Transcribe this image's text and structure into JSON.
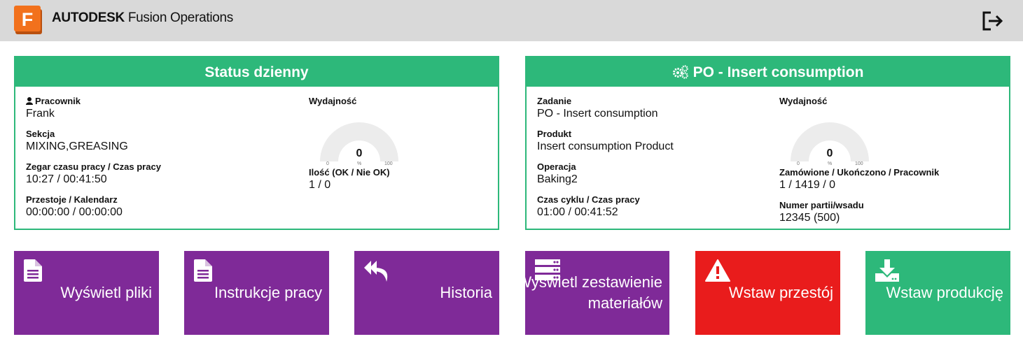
{
  "header": {
    "brand_bold": "AUTODESK",
    "brand_rest": " Fusion Operations",
    "logo_letter": "F",
    "logout_icon": "logout-icon"
  },
  "daily_status": {
    "title": "Status dzienny",
    "worker_label": "Pracownik",
    "worker": "Frank",
    "section_label": "Sekcja",
    "section": "MIXING,GREASING",
    "clock_label": "Zegar czasu pracy / Czas pracy",
    "clock": "10:27 / 00:41:50",
    "downtime_label": "Przestoje / Kalendarz",
    "downtime": "00:00:00 / 00:00:00",
    "efficiency_label": "Wydajność",
    "gauge": {
      "value": 0,
      "value_text": "0",
      "min": "0",
      "unit": "%",
      "max": "100"
    },
    "qty_label": "Ilość (OK / Nie OK)",
    "qty": "1 / 0"
  },
  "po": {
    "title": "PO - Insert consumption",
    "task_label": "Zadanie",
    "task": "PO - Insert consumption",
    "product_label": "Produkt",
    "product": "Insert consumption Product",
    "operation_label": "Operacja",
    "operation": "Baking2",
    "cycle_label": "Czas cyklu / Czas pracy",
    "cycle": "01:00 / 00:41:52",
    "efficiency_label": "Wydajność",
    "gauge": {
      "value": 0,
      "value_text": "0",
      "min": "0",
      "unit": "%",
      "max": "100"
    },
    "ordered_label": "Zamówione / Ukończono / Pracownik",
    "ordered": "1 / 1419 / 0",
    "batch_label": "Numer partii/wsadu",
    "batch": "12345 (500)"
  },
  "tiles": [
    {
      "label": "Wyświetl pliki",
      "icon": "file-icon",
      "color": "#7f2a98"
    },
    {
      "label": "Instrukcje pracy",
      "icon": "file-icon",
      "color": "#7f2a98"
    },
    {
      "label": "Historia",
      "icon": "reply-all-icon",
      "color": "#7f2a98"
    },
    {
      "label_line1": "Wyświetl zestawienie",
      "label_line2": "materiałów",
      "icon": "server-icon",
      "color": "#7f2a98"
    },
    {
      "label": "Wstaw przestój",
      "icon": "warning-icon",
      "color": "#e91c1c"
    },
    {
      "label": "Wstaw produkcję",
      "icon": "download-icon",
      "color": "#2db87a"
    }
  ]
}
